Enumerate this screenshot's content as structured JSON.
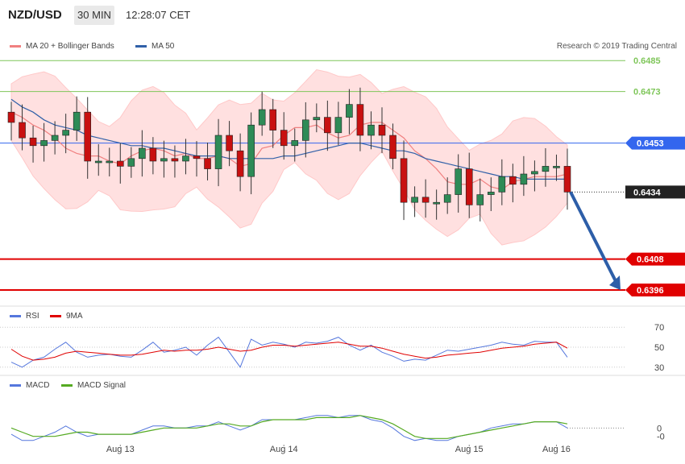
{
  "header": {
    "symbol": "NZD/USD",
    "timeframe": "30 MIN",
    "time": "12:28:07 CET"
  },
  "legend_price": {
    "bb_label": "MA 20 + Bollinger Bands",
    "ma50_label": "MA 50"
  },
  "copyright": "Research © 2019 Trading Central",
  "legend_rsi": {
    "rsi_label": "RSI",
    "ma_label": "9MA"
  },
  "legend_macd": {
    "macd_label": "MACD",
    "signal_label": "MACD Signal"
  },
  "colors": {
    "ma20": "#f08080",
    "band": "#ffe0e0",
    "ma50": "#3060a8",
    "bull": "#2e8b57",
    "bear": "#c81010",
    "level_green": "#7fc65a",
    "level_red": "#e00000",
    "level_blue": "#3366ee",
    "arrow": "#2d5ea8",
    "rsi": "#5577dd",
    "rsi_ma": "#e00000",
    "macd": "#5577dd",
    "signal": "#55aa22"
  },
  "chart_data": [
    {
      "type": "line",
      "title": "NZD/USD 30 MIN",
      "xlabel": "",
      "ylabel": "",
      "x_ticks": [
        "Aug 13",
        "Aug 14",
        "Aug 15",
        "Aug 16"
      ],
      "ylim": [
        0.6391,
        0.6496
      ],
      "levels": [
        {
          "value": "0.6485",
          "kind": "resistance"
        },
        {
          "value": "0.6473",
          "kind": "resistance"
        },
        {
          "value": "0.6453",
          "kind": "pivot"
        },
        {
          "value": "0.6434",
          "kind": "last"
        },
        {
          "value": "0.6408",
          "kind": "support"
        },
        {
          "value": "0.6396",
          "kind": "support"
        }
      ],
      "series": [
        {
          "name": "MA 20",
          "values": [
            0.6465,
            0.6463,
            0.646,
            0.6458,
            0.6455,
            0.6451,
            0.6449,
            0.6448,
            0.6448,
            0.6446,
            0.6445,
            0.6448,
            0.645,
            0.6451,
            0.645,
            0.6448,
            0.6449,
            0.6447,
            0.6447,
            0.6448,
            0.6447,
            0.6444,
            0.6445,
            0.6451,
            0.6452,
            0.6456,
            0.6459,
            0.6459,
            0.646,
            0.6457,
            0.6455,
            0.6456,
            0.646,
            0.6461,
            0.6461,
            0.6458,
            0.6455,
            0.645,
            0.6447,
            0.6443,
            0.6438,
            0.6437,
            0.6437,
            0.6439,
            0.6436,
            0.6435,
            0.6438,
            0.6439,
            0.644,
            0.644,
            0.644,
            0.6441
          ]
        },
        {
          "name": "MA 50",
          "values": [
            0.647,
            0.6467,
            0.6465,
            0.6462,
            0.646,
            0.6459,
            0.6458,
            0.6456,
            0.6455,
            0.6454,
            0.6453,
            0.6452,
            0.6452,
            0.6451,
            0.6451,
            0.645,
            0.6449,
            0.6448,
            0.6448,
            0.6448,
            0.6447,
            0.6447,
            0.6447,
            0.6447,
            0.6447,
            0.6448,
            0.6448,
            0.6449,
            0.645,
            0.6451,
            0.6452,
            0.6453,
            0.6453,
            0.6452,
            0.6451,
            0.645,
            0.645,
            0.6449,
            0.6447,
            0.6446,
            0.6445,
            0.6444,
            0.6443,
            0.6442,
            0.6441,
            0.644,
            0.644,
            0.6439,
            0.6439,
            0.6439,
            0.6439,
            0.6439
          ]
        },
        {
          "name": "Close",
          "values": [
            0.6461,
            0.6455,
            0.6452,
            0.6454,
            0.6456,
            0.6458,
            0.6465,
            0.6446,
            0.6446,
            0.6446,
            0.6444,
            0.6447,
            0.6451,
            0.6446,
            0.6447,
            0.6446,
            0.6448,
            0.6447,
            0.6443,
            0.6456,
            0.645,
            0.644,
            0.646,
            0.6466,
            0.6458,
            0.6452,
            0.6454,
            0.6462,
            0.6463,
            0.6457,
            0.6463,
            0.6468,
            0.6456,
            0.646,
            0.6456,
            0.6447,
            0.643,
            0.6432,
            0.643,
            0.643,
            0.6433,
            0.6443,
            0.6429,
            0.6433,
            0.6434,
            0.644,
            0.6437,
            0.6441,
            0.6442,
            0.6444,
            0.6444,
            0.6434
          ]
        }
      ]
    },
    {
      "type": "line",
      "title": "RSI",
      "ylim": [
        25,
        75
      ],
      "y_ticks": [
        "70",
        "50",
        "30"
      ],
      "series": [
        {
          "name": "RSI",
          "values": [
            35,
            30,
            37,
            40,
            48,
            55,
            45,
            40,
            42,
            43,
            41,
            40,
            47,
            55,
            45,
            47,
            50,
            42,
            52,
            60,
            45,
            30,
            58,
            52,
            55,
            53,
            50,
            55,
            54,
            56,
            60,
            52,
            47,
            52,
            45,
            41,
            36,
            38,
            37,
            42,
            47,
            46,
            48,
            50,
            52,
            55,
            53,
            52,
            56,
            55,
            55,
            40
          ]
        },
        {
          "name": "9MA",
          "values": [
            48,
            41,
            37,
            38,
            40,
            44,
            46,
            45,
            44,
            43,
            42,
            42,
            43,
            45,
            47,
            46,
            47,
            47,
            48,
            50,
            48,
            46,
            47,
            50,
            52,
            52,
            51,
            52,
            53,
            54,
            55,
            53,
            51,
            51,
            49,
            46,
            43,
            41,
            39,
            40,
            42,
            43,
            44,
            45,
            47,
            49,
            50,
            51,
            53,
            54,
            55,
            49
          ]
        }
      ]
    },
    {
      "type": "line",
      "title": "MACD",
      "ylim": [
        -4,
        8
      ],
      "y_ticks": [
        "0",
        "-0"
      ],
      "series": [
        {
          "name": "MACD",
          "values": [
            -1.5,
            -3,
            -3,
            -2,
            -1,
            0.5,
            -1,
            -2,
            -1.5,
            -1.5,
            -1.5,
            -1.5,
            -0.5,
            0.5,
            0.5,
            0,
            0,
            0.5,
            0.5,
            1.5,
            0.5,
            -0.5,
            0.5,
            2,
            2,
            2,
            2,
            2.5,
            3,
            3,
            2.5,
            3,
            3,
            2,
            1.5,
            0,
            -2,
            -3,
            -2.5,
            -3,
            -3,
            -2,
            -1.5,
            -1,
            0,
            0.5,
            1,
            1,
            1.5,
            1.5,
            1.5,
            0
          ]
        },
        {
          "name": "MACD Signal",
          "values": [
            0,
            -1,
            -2,
            -2,
            -2,
            -1.5,
            -1,
            -1,
            -1.5,
            -1.5,
            -1.5,
            -1.5,
            -1,
            -0.5,
            0,
            0,
            0,
            0,
            0.5,
            1,
            1,
            0.5,
            0.5,
            1.5,
            2,
            2,
            2,
            2,
            2.5,
            2.5,
            2.5,
            2.5,
            3,
            2.5,
            2,
            1,
            -0.5,
            -2,
            -2.5,
            -2.5,
            -2.5,
            -2,
            -1.5,
            -1,
            -0.5,
            0,
            0.5,
            1,
            1.5,
            1.5,
            1.5,
            1
          ]
        }
      ]
    }
  ]
}
